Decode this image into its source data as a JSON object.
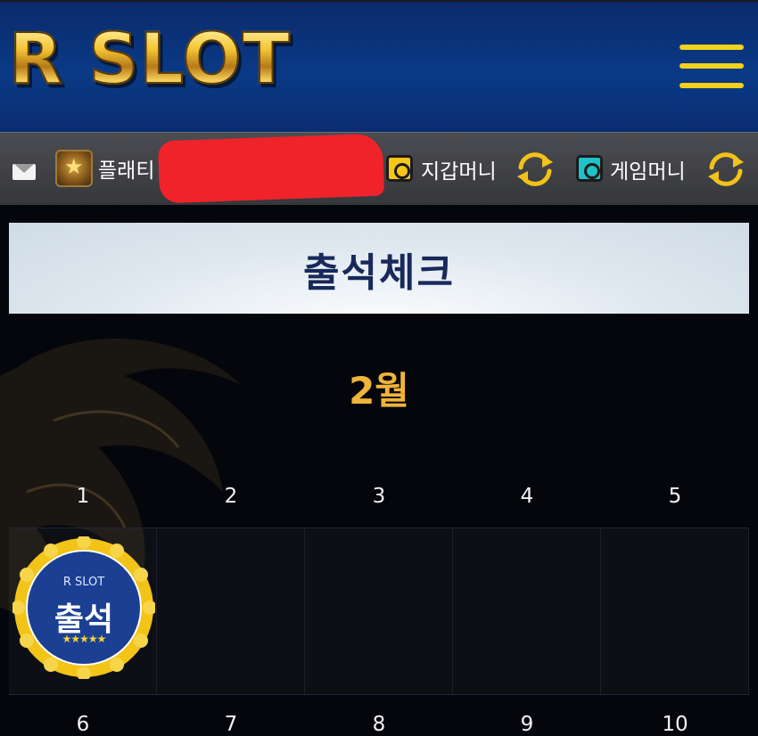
{
  "header": {
    "logo_text": "R SLOT",
    "menu_icon": "hamburger-menu-icon"
  },
  "infobar": {
    "mail_icon": "mail-icon",
    "rank_icon": "rank-star-icon",
    "username_partial": "플래티",
    "wallet_label": "지갑머니",
    "game_label": "게임머니",
    "wallet_icon_color": "#f5c518",
    "game_icon_color": "#1ec2c8",
    "refresh_icon": "refresh-icon"
  },
  "page": {
    "title": "출석체크",
    "month": "2월"
  },
  "calendar": {
    "row1_days": [
      "1",
      "2",
      "3",
      "4",
      "5"
    ],
    "row2_days": [
      "6",
      "7",
      "8",
      "9",
      "10"
    ]
  },
  "badge": {
    "brand": "R SLOT",
    "label": "출석",
    "stars": "★★★★★"
  },
  "colors": {
    "header_bg": "#0a3a86",
    "accent_gold": "#f0b43a",
    "menu_yellow": "#f2d21a",
    "title_text": "#18295a"
  }
}
